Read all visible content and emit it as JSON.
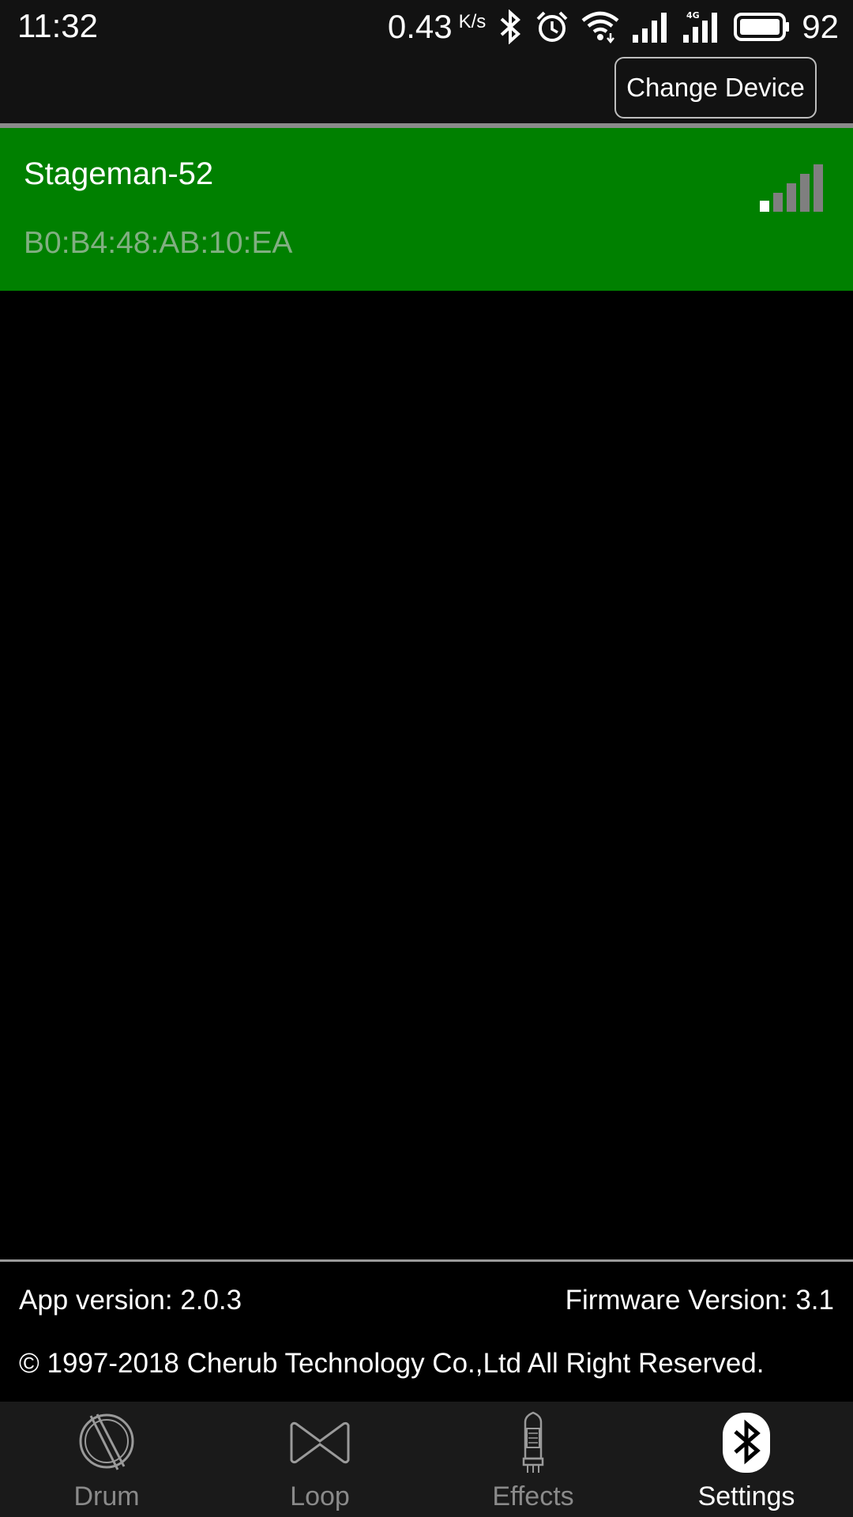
{
  "status_bar": {
    "time": "11:32",
    "speed_value": "0.43",
    "speed_unit": "K/s",
    "battery_level": "92",
    "icons": [
      "bluetooth-icon",
      "alarm-icon",
      "wifi-icon",
      "cell-signal-icon",
      "4g-signal-icon",
      "battery-icon"
    ]
  },
  "header": {
    "change_device_label": "Change Device"
  },
  "device": {
    "name": "Stageman-52",
    "mac": "B0:B4:48:AB:10:EA",
    "signal_bars_active": 1,
    "signal_bars_total": 5,
    "row_color": "#008000"
  },
  "footer": {
    "app_version": "App version: 2.0.3",
    "firmware_version": "Firmware Version: 3.1",
    "copyright": "© 1997-2018 Cherub Technology Co.,Ltd All Right Reserved."
  },
  "tabs": [
    {
      "label": "Drum",
      "icon": "drum-icon",
      "active": false
    },
    {
      "label": "Loop",
      "icon": "loop-icon",
      "active": false
    },
    {
      "label": "Effects",
      "icon": "tube-icon",
      "active": false
    },
    {
      "label": "Settings",
      "icon": "bluetooth-icon",
      "active": true
    }
  ]
}
